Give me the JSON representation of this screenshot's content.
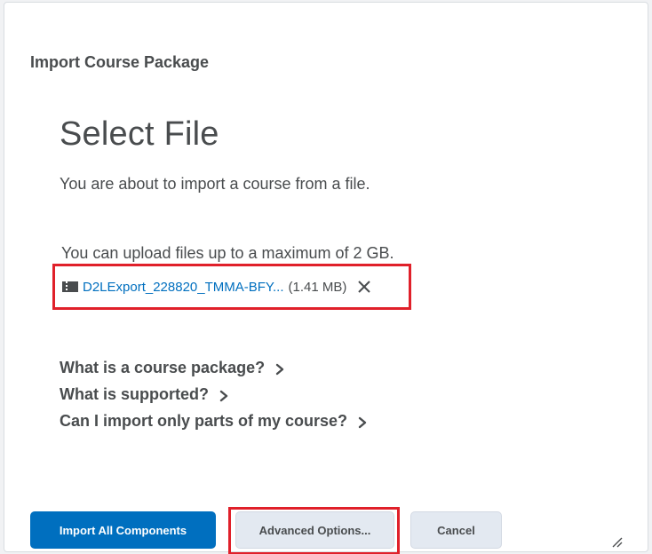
{
  "dialog": {
    "title": "Import Course Package"
  },
  "page": {
    "heading": "Select File",
    "intro": "You are about to import a course from a file.",
    "upload_limit": "You can upload files up to a maximum of 2 GB."
  },
  "file": {
    "name": "D2LExport_228820_TMMA-BFY...",
    "size": "(1.41 MB)",
    "icon": "file-archive-icon"
  },
  "help_links": [
    {
      "label": "What is a course package?"
    },
    {
      "label": "What is supported?"
    },
    {
      "label": "Can I import only parts of my course?"
    }
  ],
  "buttons": {
    "import_all": "Import All Components",
    "advanced": "Advanced Options...",
    "cancel": "Cancel"
  },
  "colors": {
    "primary": "#006fbf",
    "highlight": "#e0202a",
    "text": "#494c4e",
    "secondary_button": "#e3e9f1"
  }
}
